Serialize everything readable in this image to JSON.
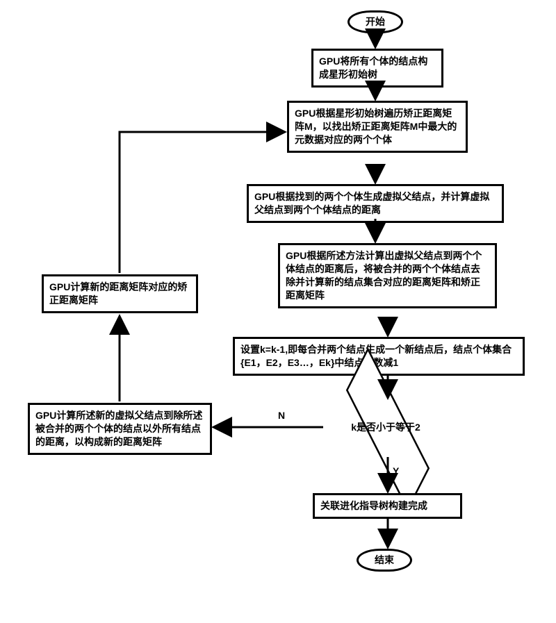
{
  "flow": {
    "start": "开始",
    "step1": "GPU将所有个体的结点构成星形初始树",
    "step2": "GPU根据星形初始树遍历矫正距离矩阵M，以找出矫正距离矩阵M中最大的元数据对应的两个个体",
    "step3": "GPU根据找到的两个个体生成虚拟父结点，并计算虚拟父结点到两个个体结点的距离",
    "step4": "GPU根据所述方法计算出虚拟父结点到两个个体结点的距离后，将被合并的两个个体结点去除并计算新的结点集合对应的距离矩阵和矫正距离矩阵",
    "step5": "设置k=k-1,即每合并两个结点生成一个新结点后，结点个体集合{E1，E2，E3…，Ek}中结点个数减1",
    "decision": "k是否小于等于2",
    "yes": "Y",
    "no": "N",
    "step6": "关联进化指导树构建完成",
    "end": "结束",
    "left1": "GPU计算所述新的虚拟父结点到除所述被合并的两个个体的结点以外所有结点的距离，以构成新的距离矩阵",
    "left2": "GPU计算新的距离矩阵对应的矫正距离矩阵"
  }
}
